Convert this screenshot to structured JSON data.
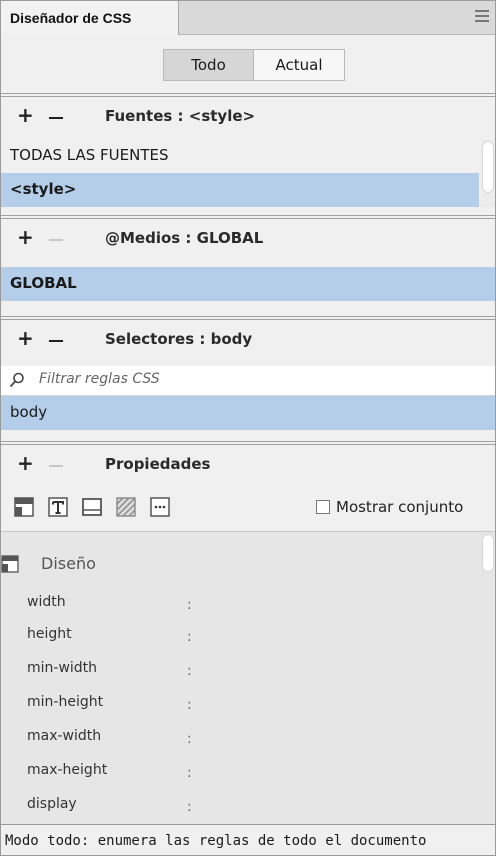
{
  "panel": {
    "title": "Diseñador de CSS"
  },
  "toggle": {
    "todo": "Todo",
    "actual": "Actual"
  },
  "fuentes": {
    "title": "Fuentes :  <style>",
    "items": [
      "TODAS LAS FUENTES",
      "<style>"
    ]
  },
  "medios": {
    "title": "@Medios :  GLOBAL",
    "items": [
      "GLOBAL"
    ]
  },
  "selectores": {
    "title": "Selectores :  body",
    "filter_placeholder": "Filtrar reglas CSS",
    "items": [
      "body"
    ]
  },
  "propiedades": {
    "title": "Propiedades",
    "show_set_label": "Mostrar conjunto",
    "category": "Diseño",
    "props": [
      "width",
      "height",
      "min-width",
      "min-height",
      "max-width",
      "max-height",
      "display"
    ],
    "colon": ":"
  },
  "status": {
    "text": "Modo todo: enumera las reglas de todo el documento"
  },
  "colors": {
    "selection": "#b4cde8",
    "panel": "#f0f0f0"
  },
  "icons": {
    "plus": "plus-icon",
    "minus": "minus-icon",
    "search": "search-icon",
    "layout": "layout-icon",
    "text": "text-icon",
    "border": "border-icon",
    "background": "background-icon",
    "more": "more-icon",
    "menu": "panel-menu-icon"
  }
}
